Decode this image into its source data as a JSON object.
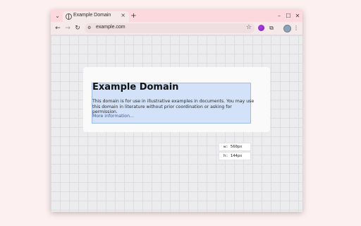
{
  "browser": {
    "tab": {
      "title": "Example Domain",
      "close_glyph": "×"
    },
    "tab_search_glyph": "⌄",
    "new_tab_glyph": "+",
    "window_controls": {
      "minimize": "–",
      "maximize": "☐",
      "close": "✕"
    },
    "nav": {
      "back": "←",
      "forward": "→",
      "reload": "↻"
    },
    "omnibox": {
      "site_info_glyph": "⚙",
      "url": "example.com",
      "bookmark_glyph": "☆"
    },
    "extensions_glyph": "⧉",
    "menu_glyph": "⋮"
  },
  "page": {
    "title": "Example Domain",
    "body": "This domain is for use in illustrative examples in documents. You may use this domain in literature without prior coordination or asking for permission.",
    "link": "More information..."
  },
  "inspector": {
    "width_label": "w: 560px",
    "height_label": "h: 144px"
  },
  "colors": {
    "tab_strip": "#fbd9dd",
    "toolbar": "#f6e9ea",
    "highlight": "#b2cef5",
    "link": "#3b5a9a"
  }
}
